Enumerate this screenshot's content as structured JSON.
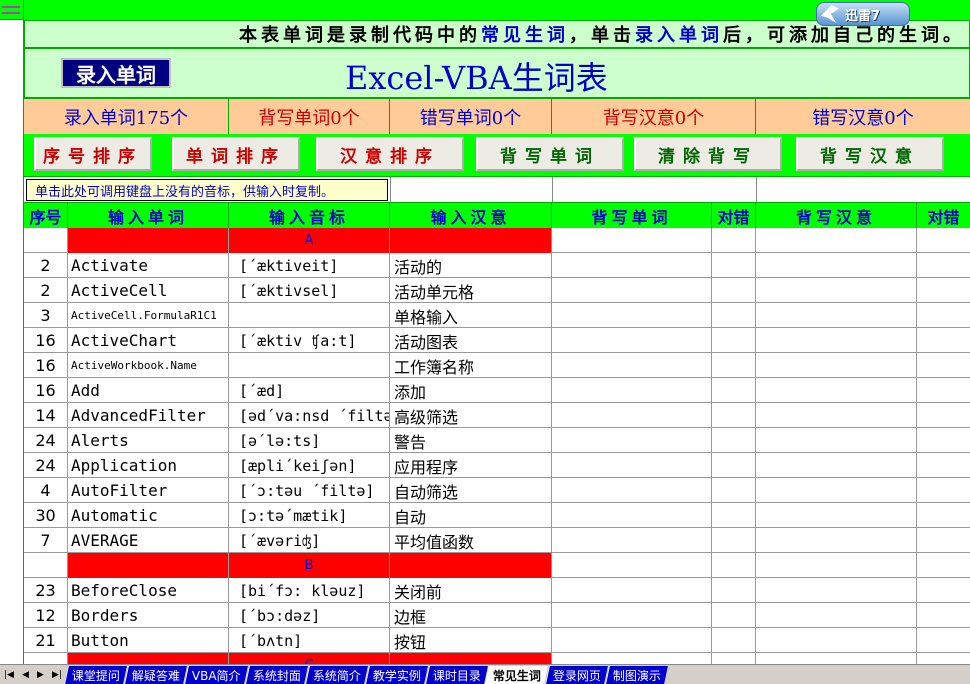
{
  "notice": {
    "part1": "本表单词是录制代码中的",
    "part2": "常见生词",
    "part3": "，单击",
    "part4": "录入单词",
    "part5": "后，可添加自己的生词。"
  },
  "title": {
    "record_button": "录入单词",
    "main_title": "Excel-VBA生词表"
  },
  "stats": [
    {
      "label": "录入单词175个",
      "color": "#0000cc"
    },
    {
      "label": "背写单词0个",
      "color": "#cc0000"
    },
    {
      "label": "错写单词0个",
      "color": "#0000cc"
    },
    {
      "label": "背写汉意0个",
      "color": "#cc0000"
    },
    {
      "label": "错写汉意0个",
      "color": "#0000cc"
    }
  ],
  "buttons": {
    "seq_sort": "序号排序",
    "word_sort": "单词排序",
    "meaning_sort": "汉意排序",
    "write_word": "背写单词",
    "clear_write": "清除背写",
    "write_meaning": "背写汉意"
  },
  "hint": "单击此处可调用键盘上没有的音标，供输入时复制。",
  "columns": {
    "seq": "序号",
    "word": "输入单词",
    "phonetic": "输入音标",
    "meaning": "输入汉意",
    "write_word": "背写单词",
    "check1": "对错",
    "write_meaning": "背写汉意",
    "check2": "对错"
  },
  "rows": [
    {
      "type": "section",
      "letter": "A"
    },
    {
      "type": "entry",
      "num": "2",
      "word": "Activate",
      "phonetic": "[´æktiveit]",
      "meaning": "活动的"
    },
    {
      "type": "entry",
      "num": "2",
      "word": "ActiveCell",
      "phonetic": "[´æktivsel]",
      "meaning": "活动单元格"
    },
    {
      "type": "entry",
      "num": "3",
      "word": "ActiveCell.FormulaR1C1",
      "phonetic": "",
      "meaning": "单格输入",
      "small": true
    },
    {
      "type": "entry",
      "num": "16",
      "word": "ActiveChart",
      "phonetic": "[´æktiv ʧa:t]",
      "meaning": "活动图表"
    },
    {
      "type": "entry",
      "num": "16",
      "word": "ActiveWorkbook.Name",
      "phonetic": "",
      "meaning": "工作簿名称",
      "small": true
    },
    {
      "type": "entry",
      "num": "16",
      "word": "Add",
      "phonetic": "[´æd]",
      "meaning": "添加"
    },
    {
      "type": "entry",
      "num": "14",
      "word": "AdvancedFilter",
      "phonetic": "[əd´va:nsd ´filtə]",
      "meaning": "高级筛选"
    },
    {
      "type": "entry",
      "num": "24",
      "word": "Alerts",
      "phonetic": "[ə´lə:ts]",
      "meaning": "警告"
    },
    {
      "type": "entry",
      "num": "24",
      "word": "Application",
      "phonetic": "[æpli´keiʃən]",
      "meaning": "应用程序"
    },
    {
      "type": "entry",
      "num": "4",
      "word": "AutoFilter",
      "phonetic": "[´ɔ:təu ´filtə]",
      "meaning": "自动筛选"
    },
    {
      "type": "entry",
      "num": "30",
      "word": "Automatic",
      "phonetic": "[ɔ:tə´mætik]",
      "meaning": "自动"
    },
    {
      "type": "entry",
      "num": "7",
      "word": "AVERAGE",
      "phonetic": "[´ævəriʤ]",
      "meaning": "平均值函数"
    },
    {
      "type": "section",
      "letter": "B"
    },
    {
      "type": "entry",
      "num": "23",
      "word": "BeforeClose",
      "phonetic": "[bi´fɔ: kləuz]",
      "meaning": "关闭前"
    },
    {
      "type": "entry",
      "num": "12",
      "word": "Borders",
      "phonetic": "[´bɔ:dəz]",
      "meaning": "边框"
    },
    {
      "type": "entry",
      "num": "21",
      "word": "Button",
      "phonetic": "[´bʌtn]",
      "meaning": "按钮"
    },
    {
      "type": "section",
      "letter": "C"
    }
  ],
  "tabs": [
    {
      "label": "课堂提问",
      "active": false
    },
    {
      "label": "解疑答难",
      "active": false
    },
    {
      "label": "VBA简介",
      "active": false
    },
    {
      "label": "系统封面",
      "active": false
    },
    {
      "label": "系统简介",
      "active": false
    },
    {
      "label": "教学实例",
      "active": false
    },
    {
      "label": "课时目录",
      "active": false
    },
    {
      "label": "常见生词",
      "active": true
    },
    {
      "label": "登录网页",
      "active": false
    },
    {
      "label": "制图演示",
      "active": false
    }
  ],
  "badge": {
    "label": "迅雷7"
  },
  "nav_icons": [
    "first-sheet-icon",
    "prev-sheet-icon",
    "next-sheet-icon",
    "last-sheet-icon"
  ]
}
